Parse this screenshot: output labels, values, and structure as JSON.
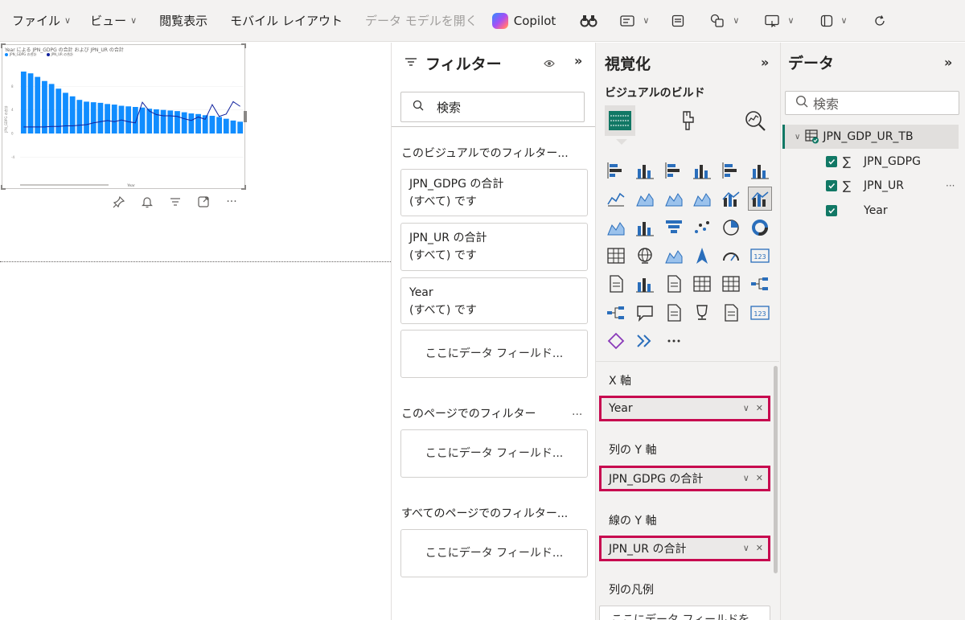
{
  "ribbon": {
    "file": "ファイル",
    "view": "ビュー",
    "reading_view": "閲覧表示",
    "mobile_layout": "モバイル レイアウト",
    "open_data_model": "データ モデルを開く",
    "copilot": "Copilot"
  },
  "visual": {
    "title": "Year による JPN_GDPG の合計 および JPN_UR の合計",
    "legend": [
      "JPN_GDPG の合計",
      "JPN_UR の合計"
    ],
    "ylabel": "JPN_GDPG の合計",
    "xlabel": "Year"
  },
  "chart_data": {
    "type": "bar",
    "title": "Year による JPN_GDPG の合計 および JPN_UR の合計",
    "xlabel": "Year",
    "ylabel": "JPN_GDPG の合計",
    "ylim": [
      -6,
      12
    ],
    "y_ticks": [
      -4,
      0,
      4,
      8
    ],
    "series": [
      {
        "name": "JPN_GDPG の合計",
        "kind": "bar",
        "color": "#118dff",
        "values": [
          10.5,
          10.2,
          9.6,
          8.9,
          8.4,
          7.6,
          6.9,
          6.3,
          5.7,
          5.4,
          5.3,
          5.2,
          5.0,
          4.9,
          4.7,
          4.6,
          4.5,
          4.4,
          4.2,
          4.1,
          4.0,
          3.9,
          3.8,
          3.6,
          3.4,
          3.3,
          3.1,
          3.0,
          2.8,
          2.5,
          2.2,
          2.0
        ]
      },
      {
        "name": "JPN_UR の合計",
        "kind": "line",
        "color": "#12239e",
        "values": [
          1.1,
          1.1,
          1.1,
          1.1,
          1.2,
          1.2,
          1.3,
          1.3,
          1.4,
          1.5,
          1.8,
          2.0,
          2.2,
          2.0,
          2.3,
          2.0,
          1.8,
          5.3,
          3.8,
          3.2,
          3.0,
          3.0,
          2.9,
          2.5,
          2.2,
          2.8,
          2.4,
          4.9,
          2.9,
          3.3,
          5.4,
          4.6
        ]
      }
    ]
  },
  "filters": {
    "title": "フィルター",
    "search": "検索",
    "visual_section": "このビジュアルでのフィルター...",
    "page_section": "このページでのフィルター",
    "all_pages_section": "すべてのページでのフィルター...",
    "more": "...",
    "cards": [
      {
        "field": "JPN_GDPG の合計",
        "state": "(すべて) です"
      },
      {
        "field": "JPN_UR の合計",
        "state": "(すべて) です"
      },
      {
        "field": "Year",
        "state": "(すべて) です"
      }
    ],
    "drop_label": "ここにデータ フィールド..."
  },
  "visualizations": {
    "title": "視覚化",
    "build_label": "ビジュアルのビルド",
    "more": "...",
    "x_axis_label": "X 軸",
    "x_axis_value": "Year",
    "col_y_label": "列の Y 軸",
    "col_y_value": "JPN_GDPG の合計",
    "line_y_label": "線の Y 軸",
    "line_y_value": "JPN_UR の合計",
    "legend_label": "列の凡例",
    "legend_drop": "ここにデータ フィールドを"
  },
  "data": {
    "title": "データ",
    "search": "検索",
    "table": "JPN_GDP_UR_TB",
    "fields": [
      {
        "name": "JPN_GDPG",
        "sigma": "∑"
      },
      {
        "name": "JPN_UR",
        "sigma": "∑"
      },
      {
        "name": "Year",
        "sigma": ""
      }
    ],
    "field_more": "···"
  },
  "colors": {
    "accent": "#117865",
    "highlight": "#c7084f",
    "bar": "#118dff",
    "line": "#12239e"
  }
}
